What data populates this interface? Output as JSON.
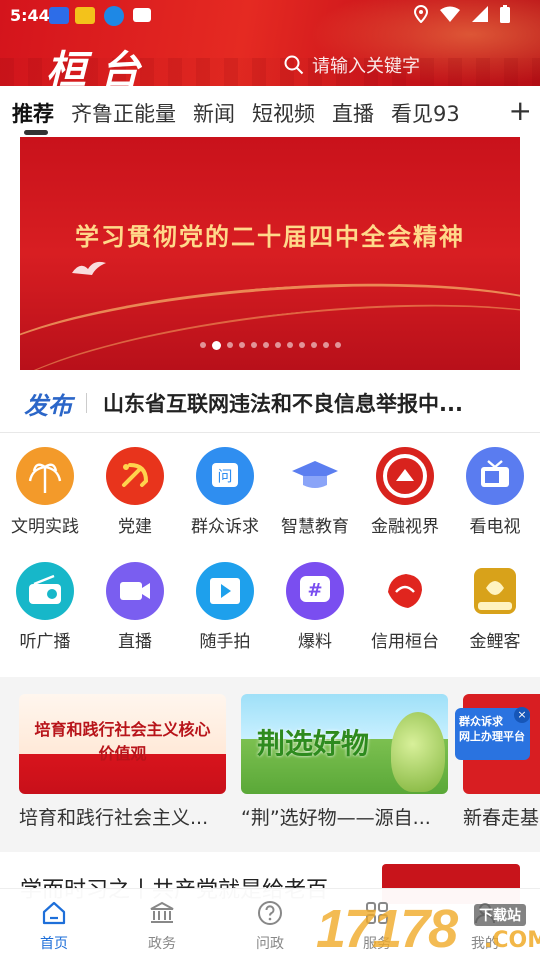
{
  "status_bar": {
    "time": "5:44"
  },
  "header": {
    "logo": "桓台",
    "search_placeholder": "请输入关键字"
  },
  "tabs": [
    "推荐",
    "齐鲁正能量",
    "新闻",
    "短视频",
    "直播",
    "看见93"
  ],
  "banner": {
    "title": "学习贯彻党的二十届四中全会精神",
    "dot_count": 12,
    "active_dot": 1
  },
  "notice": {
    "logo": "发布",
    "text": "山东省互联网违法和不良信息举报中..."
  },
  "services": [
    {
      "label": "文明实践",
      "icon": "civilization-practice-icon",
      "color": "#f39a2a"
    },
    {
      "label": "党建",
      "icon": "party-building-icon",
      "color": "#e8341c"
    },
    {
      "label": "群众诉求",
      "icon": "public-appeal-icon",
      "color": "#2f8ef0"
    },
    {
      "label": "智慧教育",
      "icon": "graduation-cap-icon",
      "color": "#4c6fd8"
    },
    {
      "label": "金融视界",
      "icon": "finance-icon",
      "color": "#d8231d"
    },
    {
      "label": "看电视",
      "icon": "tv-icon",
      "color": "#5a7cf0"
    },
    {
      "label": "听广播",
      "icon": "radio-icon",
      "color": "#17b7c9"
    },
    {
      "label": "直播",
      "icon": "live-video-icon",
      "color": "#7a5ef0"
    },
    {
      "label": "随手拍",
      "icon": "film-icon",
      "color": "#1ea0ec"
    },
    {
      "label": "爆料",
      "icon": "hashtag-icon",
      "color": "#7a4ef0"
    },
    {
      "label": "信用桓台",
      "icon": "credit-map-icon",
      "color": "#e0251e"
    },
    {
      "label": "金鲤客",
      "icon": "golden-carp-icon",
      "color": "#d8a21a"
    }
  ],
  "cards": [
    {
      "title": "培育和践行社会主义...",
      "image_text": "培育和践行社会主义核心价值观"
    },
    {
      "title": "“荆”选好物——源自...",
      "image_text": "荆选好物"
    },
    {
      "title": "新春走基"
    }
  ],
  "float_banner": {
    "line1": "群众诉求",
    "line2": "网上办理平台"
  },
  "article": {
    "title": "学而时习之丨共产党就是给老百"
  },
  "bottom_nav": [
    {
      "label": "首页",
      "icon": "home-icon"
    },
    {
      "label": "政务",
      "icon": "government-icon"
    },
    {
      "label": "问政",
      "icon": "question-icon"
    },
    {
      "label": "服务",
      "icon": "service-icon"
    },
    {
      "label": "我的",
      "icon": "profile-icon"
    }
  ],
  "watermark": {
    "text": "17178",
    "sub": ".COM",
    "badge": "下载站"
  }
}
